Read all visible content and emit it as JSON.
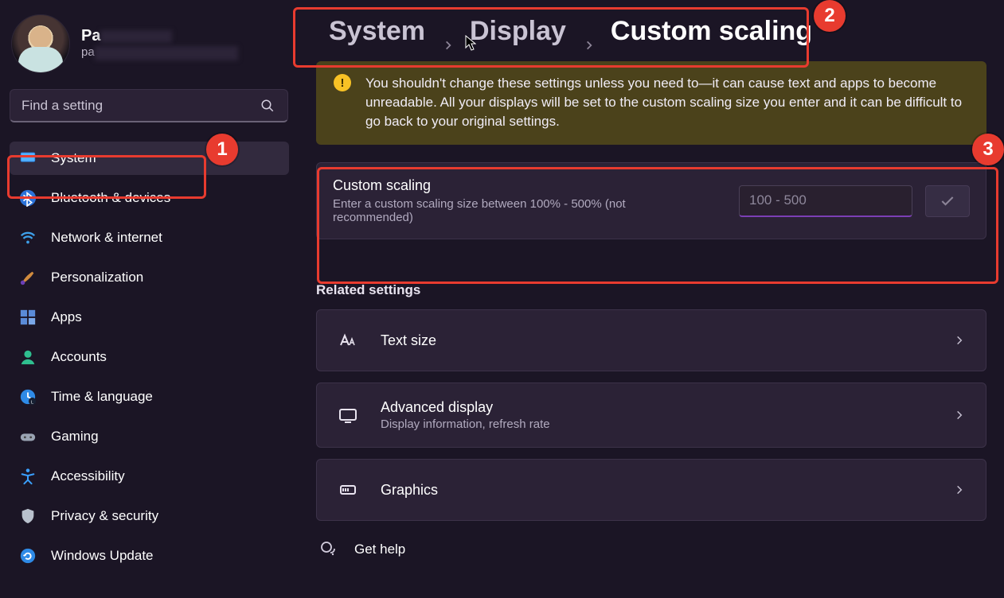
{
  "user": {
    "name_visible": "Pa",
    "sub_visible": "pa"
  },
  "search": {
    "placeholder": "Find a setting"
  },
  "sidebar": {
    "items": [
      {
        "key": "system",
        "label": "System"
      },
      {
        "key": "bluetooth",
        "label": "Bluetooth & devices"
      },
      {
        "key": "network",
        "label": "Network & internet"
      },
      {
        "key": "personalization",
        "label": "Personalization"
      },
      {
        "key": "apps",
        "label": "Apps"
      },
      {
        "key": "accounts",
        "label": "Accounts"
      },
      {
        "key": "time",
        "label": "Time & language"
      },
      {
        "key": "gaming",
        "label": "Gaming"
      },
      {
        "key": "accessibility",
        "label": "Accessibility"
      },
      {
        "key": "privacy",
        "label": "Privacy & security"
      },
      {
        "key": "update",
        "label": "Windows Update"
      }
    ]
  },
  "breadcrumb": {
    "part1": "System",
    "part2": "Display",
    "part3": "Custom scaling"
  },
  "warning": {
    "text": "You shouldn't change these settings unless you need to—it can cause text and apps to become unreadable. All your displays will be set to the custom scaling size you enter and it can be difficult to go back to your original settings."
  },
  "scaling": {
    "title": "Custom scaling",
    "subtitle": "Enter a custom scaling size between 100% - 500% (not recommended)",
    "placeholder": "100 - 500"
  },
  "related": {
    "heading": "Related settings",
    "items": [
      {
        "key": "textsize",
        "title": "Text size",
        "sub": ""
      },
      {
        "key": "advdisplay",
        "title": "Advanced display",
        "sub": "Display information, refresh rate"
      },
      {
        "key": "graphics",
        "title": "Graphics",
        "sub": ""
      }
    ]
  },
  "help": {
    "label": "Get help"
  },
  "annotations": {
    "badge1": "1",
    "badge2": "2",
    "badge3": "3"
  }
}
